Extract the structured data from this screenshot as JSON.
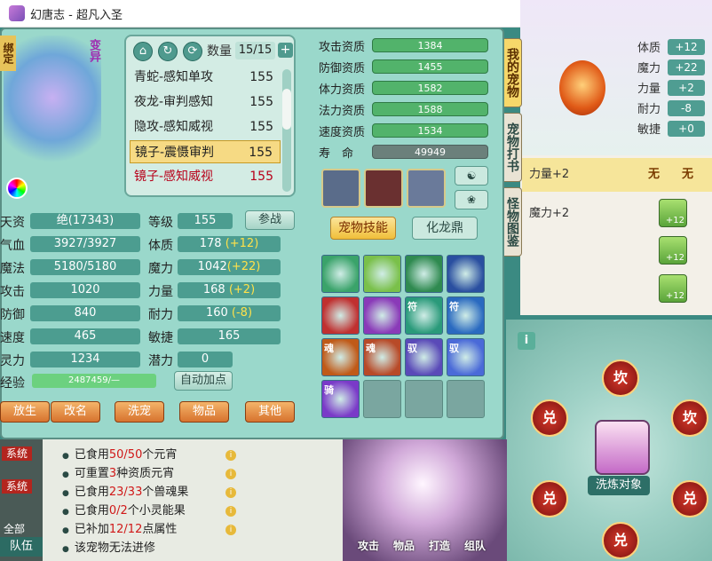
{
  "window": {
    "title": "幻唐志 - 超凡入圣",
    "minimize": "—",
    "maximize": "☐",
    "close": "✕"
  },
  "pet": {
    "badge_left": "绑定",
    "badge_right": "变异",
    "qty_label": "数量",
    "qty_value": "15/15",
    "plus": "+",
    "list": [
      {
        "name": "青蛇-感知单攻",
        "level": "155"
      },
      {
        "name": "夜龙-审判感知",
        "level": "155"
      },
      {
        "name": "隐攻-感知威视",
        "level": "155"
      },
      {
        "name": "镜子-震慑审判",
        "level": "155",
        "selected": true
      },
      {
        "name": "镜子-感知威视",
        "level": "155",
        "highlight": true
      }
    ]
  },
  "stats": {
    "talent_lbl": "天资",
    "talent_val": "绝(17343)",
    "grade_lbl": "等级",
    "grade_val": "155",
    "battle_btn": "参战",
    "hp_lbl": "气血",
    "hp_val": "3927/3927",
    "con_lbl": "体质",
    "con_val": "178",
    "con_plus": "(+12)",
    "mp_lbl": "魔法",
    "mp_val": "5180/5180",
    "mag_lbl": "魔力",
    "mag_val": "1042",
    "mag_plus": "(+22)",
    "atk_lbl": "攻击",
    "atk_val": "1020",
    "str_lbl": "力量",
    "str_val": "168",
    "str_plus": "(+2)",
    "def_lbl": "防御",
    "def_val": "840",
    "end_lbl": "耐力",
    "end_val": "160",
    "end_plus": "(-8)",
    "spd_lbl": "速度",
    "spd_val": "465",
    "agi_lbl": "敏捷",
    "agi_val": "165",
    "spi_lbl": "灵力",
    "spi_val": "1234",
    "pot_lbl": "潜力",
    "pot_val": "0",
    "exp_lbl": "经验",
    "exp_val": "2487459/—",
    "exp_fill": 1.0,
    "auto_btn": "自动加点"
  },
  "bottom_buttons": [
    "放生",
    "改名",
    "洗宠",
    "物品",
    "其他"
  ],
  "aptitude": [
    {
      "label": "攻击资质",
      "value": "1384"
    },
    {
      "label": "防御资质",
      "value": "1455"
    },
    {
      "label": "体力资质",
      "value": "1582"
    },
    {
      "label": "法力资质",
      "value": "1588"
    },
    {
      "label": "速度资质",
      "value": "1534"
    },
    {
      "label": "寿　命",
      "value": "49949"
    }
  ],
  "tabs": {
    "skill": "宠物技能",
    "dragon": "化龙鼎"
  },
  "skills": [
    "",
    "",
    "",
    "",
    "",
    "",
    "符",
    "符",
    "魂",
    "魂",
    "驭",
    "驭",
    "骑",
    "",
    "",
    ""
  ],
  "side_tabs": [
    "我的宠物",
    "宠物打书",
    "怪物图鉴"
  ],
  "right_stats": [
    {
      "label": "体质",
      "value": "+12"
    },
    {
      "label": "魔力",
      "value": "+22"
    },
    {
      "label": "力量",
      "value": "+2"
    },
    {
      "label": "耐力",
      "value": "-8"
    },
    {
      "label": "敏捷",
      "value": "+0"
    }
  ],
  "attr_table": {
    "row1": "力量+2",
    "col_a": "无",
    "col_b": "无",
    "row2": "魔力+2",
    "icon_vals": [
      "+12",
      "+12",
      "+12"
    ]
  },
  "wash": {
    "label": "洗炼对象",
    "info": "i"
  },
  "runes": [
    "坎",
    "兑",
    "坎",
    "兑",
    "兑",
    "兑"
  ],
  "bullets": [
    {
      "pre": "已食用",
      "red": "50/50",
      "post": "个元宵"
    },
    {
      "pre": "可重置",
      "red": "3",
      "post": "种资质元宵"
    },
    {
      "pre": "已食用",
      "red": "23/33",
      "post": "个兽魂果"
    },
    {
      "pre": "已食用",
      "red": "0/2",
      "post": "个小灵能果"
    },
    {
      "pre": "已补加",
      "red": "12/12",
      "post": "点属性"
    },
    {
      "pre": "该宠物无法进修",
      "red": "",
      "post": ""
    }
  ],
  "chat": {
    "tag1": "系统",
    "tag2": "系统",
    "all": "全部",
    "team": "队伍"
  },
  "actions": [
    "攻击",
    "物品",
    "打造",
    "组队"
  ],
  "colors": {
    "accent": "#4c9d90",
    "gold": "#f6da84",
    "red": "#d01818"
  }
}
